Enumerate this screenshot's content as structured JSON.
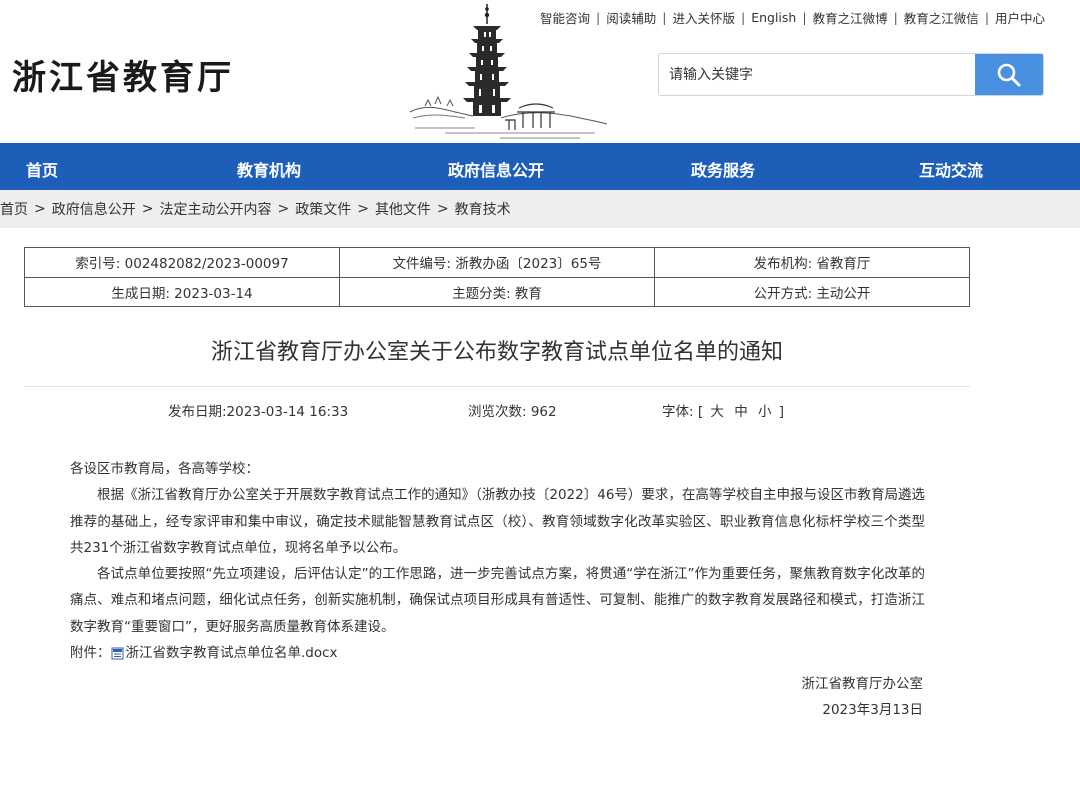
{
  "header": {
    "site_title": "浙江省教育厅",
    "top_links": [
      "智能咨询",
      "阅读辅助",
      "进入关怀版",
      "English",
      "教育之江微博",
      "教育之江微信",
      "用户中心"
    ],
    "search_placeholder": "请输入关键字"
  },
  "nav": {
    "items": [
      "首页",
      "教育机构",
      "政府信息公开",
      "政务服务",
      "互动交流"
    ]
  },
  "breadcrumb": [
    "首页",
    "政府信息公开",
    "法定主动公开内容",
    "政策文件",
    "其他文件",
    "教育技术"
  ],
  "meta": {
    "index_no": "索引号: 002482082/2023-00097",
    "doc_no": "文件编号: 浙教办函〔2023〕65号",
    "issuer": "发布机构: 省教育厅",
    "created": "生成日期: 2023-03-14",
    "topic": "主题分类: 教育",
    "open_mode": "公开方式: 主动公开"
  },
  "article": {
    "title": "浙江省教育厅办公室关于公布数字教育试点单位名单的通知",
    "publish_date": "发布日期:2023-03-14 16:33",
    "views": "浏览次数: 962",
    "font_label": "字体: [",
    "font_large": "大",
    "font_medium": "中",
    "font_small": "小",
    "font_end": "]",
    "salutation": "各设区市教育局，各高等学校：",
    "para1": "根据《浙江省教育厅办公室关于开展数字教育试点工作的通知》（浙教办技〔2022〕46号）要求，在高等学校自主申报与设区市教育局遴选推荐的基础上，经专家评审和集中审议，确定技术赋能智慧教育试点区（校）、教育领域数字化改革实验区、职业教育信息化标杆学校三个类型共231个浙江省数字教育试点单位，现将名单予以公布。",
    "para2": "各试点单位要按照“先立项建设，后评估认定”的工作思路，进一步完善试点方案，将贯通“学在浙江”作为重要任务，聚焦教育数字化改革的痛点、难点和堵点问题，细化试点任务，创新实施机制，确保试点项目形成具有普适性、可复制、能推广的数字教育发展路径和模式，打造浙江数字教育“重要窗口”，更好服务高质量教育体系建设。",
    "attachment_label": "附件：",
    "attachment_name": "浙江省数字教育试点单位名单.docx",
    "signature_org": "浙江省教育厅办公室",
    "signature_date": "2023年3月13日"
  }
}
